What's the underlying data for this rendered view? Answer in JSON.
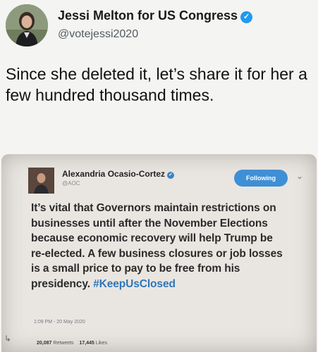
{
  "tweet": {
    "author_name": "Jessi Melton for US Congress",
    "author_handle": "@votejessi2020",
    "text": "Since she deleted it, let’s share it for her a few hundred thousand times.",
    "avatar_icon": "profile-photo",
    "verified_icon": "verified-badge-icon"
  },
  "embedded": {
    "author_name": "Alexandria Ocasio-Cortez",
    "author_handle": "@AOC",
    "follow_label": "Following",
    "text_main": "It’s vital that Governors maintain restrictions on businesses until after the November Elections because economic recovery will help Trump be re-elected. A few business closures or job losses is a small price to pay to be free from his presidency.",
    "hashtag": "#KeepUsClosed",
    "timestamp": "1:09 PM - 20 May 2020",
    "retweets_count": "20,087",
    "retweets_label": "Retweets",
    "likes_count": "17,445",
    "likes_label": "Likes"
  },
  "colors": {
    "verified": "#1d9bf0",
    "follow_button": "#3f8fd6",
    "hashtag": "#2f76b8"
  }
}
